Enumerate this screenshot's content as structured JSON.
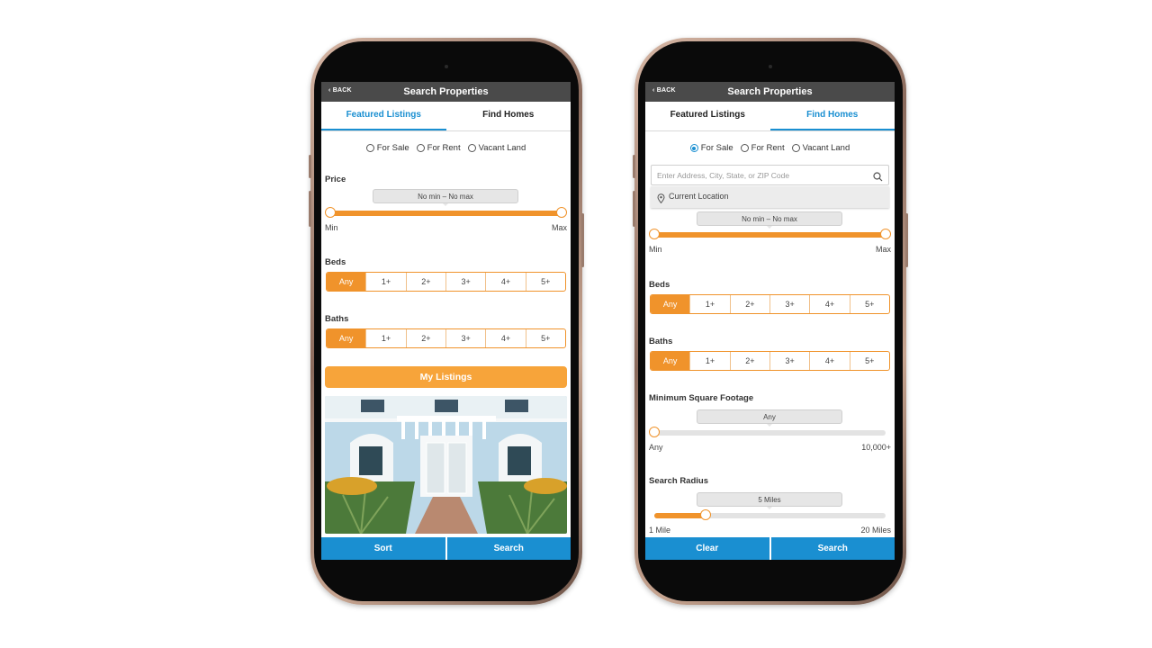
{
  "colors": {
    "accent": "#f0932b",
    "blue": "#1a8fd1",
    "navbar": "#4a4a4a"
  },
  "phones": [
    {
      "back": "BACK",
      "title": "Search Properties",
      "tab1": "Featured Listings",
      "tab2": "Find Homes",
      "active_tab": "Featured Listings",
      "radios": [
        "For Sale",
        "For Rent",
        "Vacant Land"
      ],
      "selected_radio": null,
      "price_label": "Price",
      "price_pill": "No min – No max",
      "price_min": "Min",
      "price_max": "Max",
      "beds_label": "Beds",
      "baths_label": "Baths",
      "options": [
        "Any",
        "1+",
        "2+",
        "3+",
        "4+",
        "5+"
      ],
      "selected_option": "Any",
      "my_listings": "My Listings",
      "btn_left": "Sort",
      "btn_right": "Search"
    },
    {
      "back": "BACK",
      "title": "Search Properties",
      "tab1": "Featured Listings",
      "tab2": "Find Homes",
      "active_tab": "Find Homes",
      "radios": [
        "For Sale",
        "For Rent",
        "Vacant Land"
      ],
      "selected_radio": "For Sale",
      "search_placeholder": "Enter Address, City, State, or ZIP Code",
      "current_location": "Current Location",
      "price_pill": "No min – No max",
      "price_min": "Min",
      "price_max": "Max",
      "beds_label": "Beds",
      "baths_label": "Baths",
      "options": [
        "Any",
        "1+",
        "2+",
        "3+",
        "4+",
        "5+"
      ],
      "selected_option": "Any",
      "sqft_label": "Minimum Square Footage",
      "sqft_pill": "Any",
      "sqft_min": "Any",
      "sqft_max": "10,000+",
      "sqft_level": 0,
      "radius_label": "Search Radius",
      "radius_pill": "5 Miles",
      "radius_min": "1 Mile",
      "radius_max": "20 Miles",
      "radius_level": 0.22,
      "btn_left": "Clear",
      "btn_right": "Search"
    }
  ]
}
